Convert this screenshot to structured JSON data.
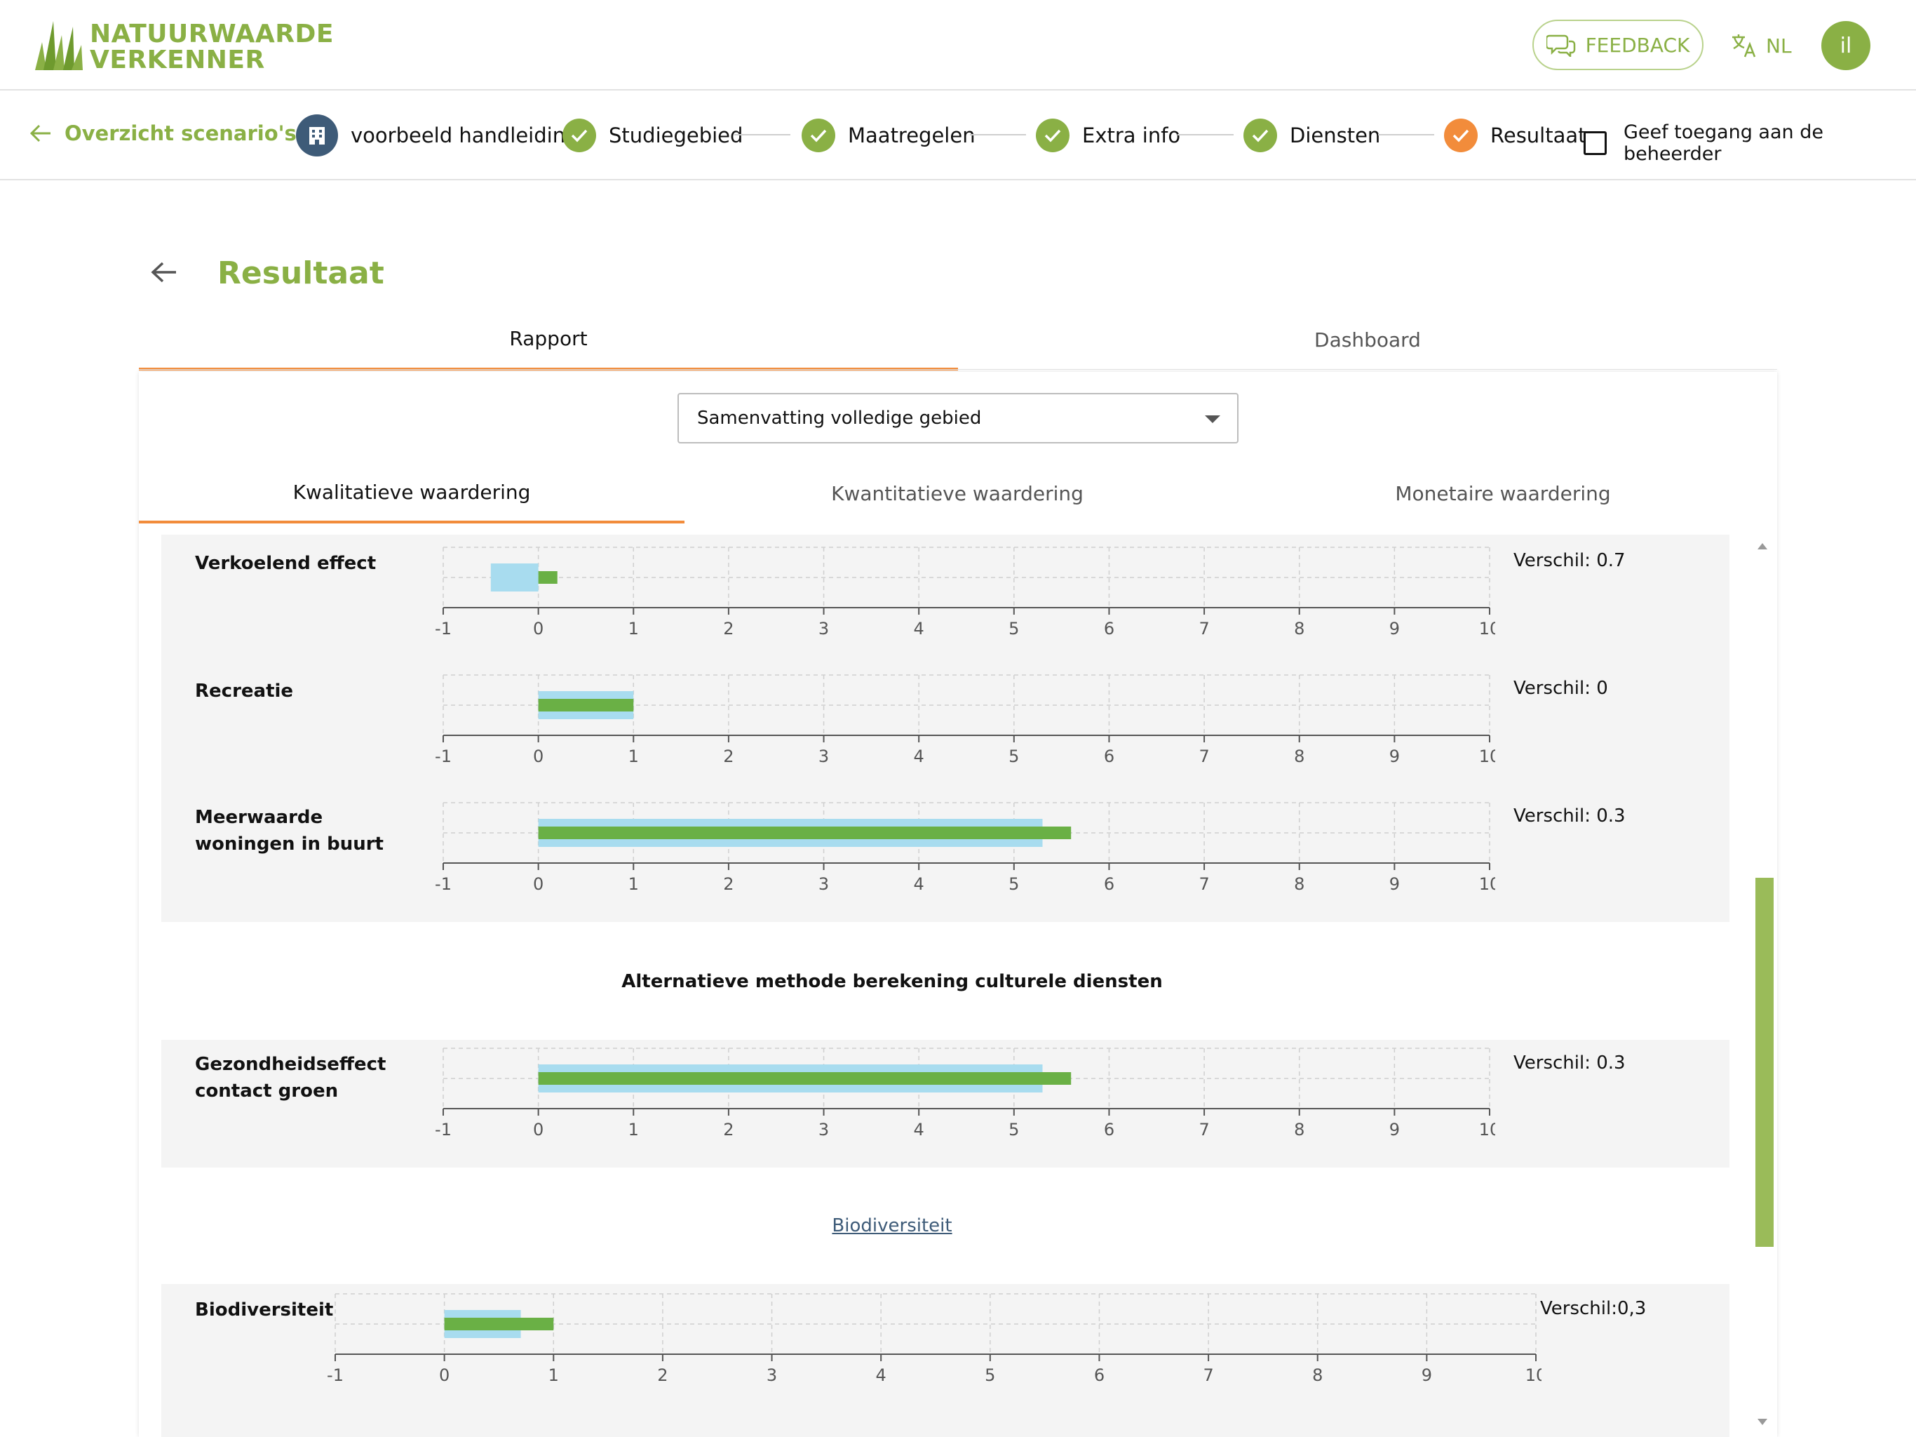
{
  "header": {
    "logo_line1": "NATUURWAARDE",
    "logo_line2": "VERKENNER",
    "feedback_label": "FEEDBACK",
    "language": "NL",
    "avatar_initials": "il"
  },
  "stepper": {
    "back_label": "Overzicht scenario's",
    "scenario_name": "voorbeeld handleiding",
    "steps": [
      {
        "label": "Studiegebied",
        "status": "done"
      },
      {
        "label": "Maatregelen",
        "status": "done"
      },
      {
        "label": "Extra info",
        "status": "done"
      },
      {
        "label": "Diensten",
        "status": "done"
      },
      {
        "label": "Resultaat",
        "status": "current"
      }
    ],
    "access_label": "Geef toegang aan de beheerder",
    "access_checked": false
  },
  "page": {
    "title": "Resultaat",
    "tabs": [
      "Rapport",
      "Dashboard"
    ],
    "active_tab": "Rapport"
  },
  "report": {
    "select_value": "Samenvatting volledige gebied",
    "sub_tabs": [
      "Kwalitatieve waardering",
      "Kwantitatieve waardering",
      "Monetaire waardering"
    ],
    "active_sub_tab": "Kwalitatieve waardering",
    "section_alt_title": "Alternatieve methode berekening culturele diensten",
    "section_bio_link": "Biodiversiteit"
  },
  "colors": {
    "brand_green": "#8ab045",
    "accent_orange": "#f28c3b",
    "bar_before": "#a8dcef",
    "bar_after": "#6ab045",
    "scenario_icon_bg": "#3e5b78"
  },
  "chart_data": [
    {
      "type": "bar",
      "orientation": "horizontal",
      "label": "Verkoelend effect",
      "difference_text": "Verschil: 0.7",
      "xlim": [
        -1,
        10
      ],
      "ticks": [
        -1,
        0,
        1,
        2,
        3,
        4,
        5,
        6,
        7,
        8,
        9,
        10
      ],
      "series": [
        {
          "values": [
            -0.5
          ]
        },
        {
          "values": [
            0.2
          ]
        }
      ]
    },
    {
      "type": "bar",
      "orientation": "horizontal",
      "label": "Recreatie",
      "difference_text": "Verschil: 0",
      "xlim": [
        -1,
        10
      ],
      "ticks": [
        -1,
        0,
        1,
        2,
        3,
        4,
        5,
        6,
        7,
        8,
        9,
        10
      ],
      "series": [
        {
          "values": [
            1.0
          ]
        },
        {
          "values": [
            1.0
          ]
        }
      ]
    },
    {
      "type": "bar",
      "orientation": "horizontal",
      "label": "Meerwaarde woningen in buurt",
      "difference_text": "Verschil: 0.3",
      "xlim": [
        -1,
        10
      ],
      "ticks": [
        -1,
        0,
        1,
        2,
        3,
        4,
        5,
        6,
        7,
        8,
        9,
        10
      ],
      "series": [
        {
          "values": [
            5.3
          ]
        },
        {
          "values": [
            5.6
          ]
        }
      ]
    },
    {
      "type": "bar",
      "orientation": "horizontal",
      "label": "Gezondheidseffect contact groen",
      "difference_text": "Verschil: 0.3",
      "xlim": [
        -1,
        10
      ],
      "ticks": [
        -1,
        0,
        1,
        2,
        3,
        4,
        5,
        6,
        7,
        8,
        9,
        10
      ],
      "series": [
        {
          "values": [
            5.3
          ]
        },
        {
          "values": [
            5.6
          ]
        }
      ]
    },
    {
      "type": "bar",
      "orientation": "horizontal",
      "label": "Biodiversiteit",
      "difference_text": "Verschil:0,3",
      "xlim": [
        -1,
        10
      ],
      "ticks": [
        -1,
        0,
        1,
        2,
        3,
        4,
        5,
        6,
        7,
        8,
        9,
        10
      ],
      "series": [
        {
          "values": [
            0.7
          ]
        },
        {
          "values": [
            1.0
          ]
        }
      ]
    }
  ]
}
